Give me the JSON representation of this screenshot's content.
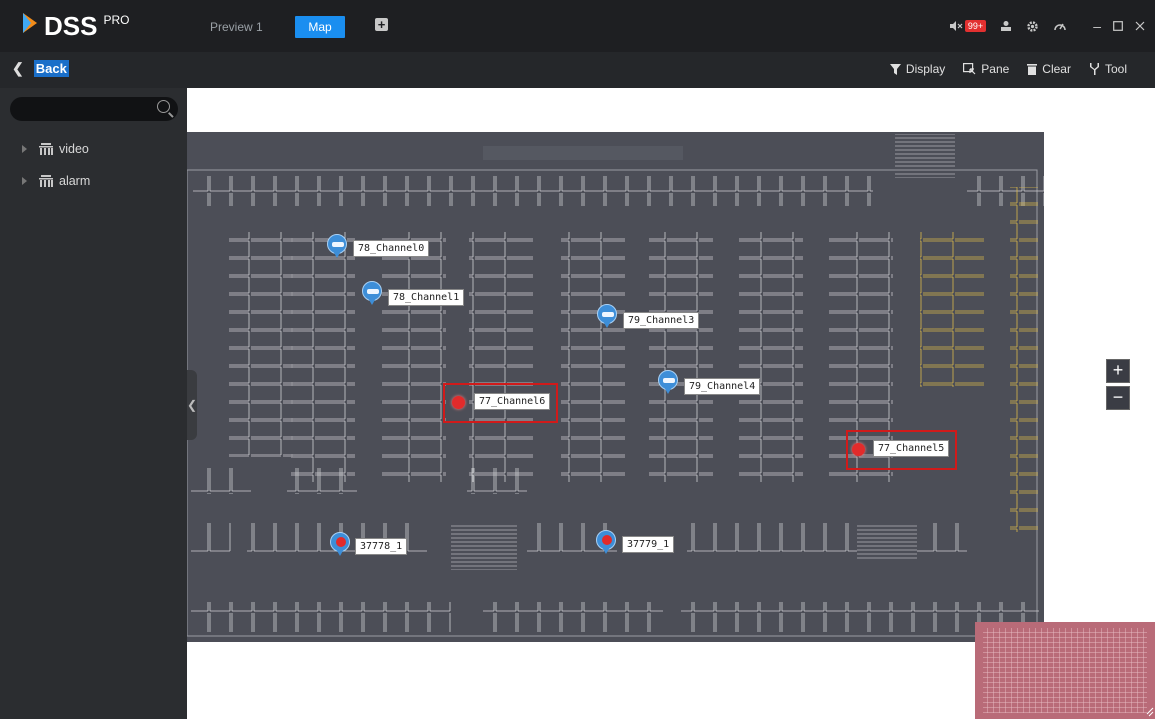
{
  "app": {
    "brand": "DSS",
    "edition": "PRO"
  },
  "tabs": [
    {
      "label": "Preview 1",
      "active": false
    },
    {
      "label": "Map",
      "active": true
    }
  ],
  "titlebar_icons": [
    "mute-icon",
    "notification-count",
    "user-icon",
    "settings-icon",
    "performance-icon",
    "minimize-icon",
    "maximize-icon",
    "close-icon"
  ],
  "notification_count": "99+",
  "subbar": {
    "back_label": "Back",
    "tools": [
      {
        "label": "Display",
        "icon": "filter-icon"
      },
      {
        "label": "Pane",
        "icon": "pane-icon"
      },
      {
        "label": "Clear",
        "icon": "clear-icon"
      },
      {
        "label": "Tool",
        "icon": "tool-icon"
      }
    ]
  },
  "sidebar": {
    "search_placeholder": "",
    "tree": [
      {
        "label": "video",
        "icon": "device-tree-icon"
      },
      {
        "label": "alarm",
        "icon": "device-tree-icon"
      }
    ]
  },
  "map": {
    "channels": [
      {
        "label": "78_Channel0",
        "type": "camera",
        "alarm": false
      },
      {
        "label": "78_Channel1",
        "type": "camera",
        "alarm": false
      },
      {
        "label": "79_Channel3",
        "type": "camera",
        "alarm": false
      },
      {
        "label": "79_Channel4",
        "type": "camera",
        "alarm": false
      },
      {
        "label": "77_Channel6",
        "type": "alarm-input",
        "alarm": true
      },
      {
        "label": "77_Channel5",
        "type": "alarm-input",
        "alarm": true
      },
      {
        "label": "37778_1",
        "type": "camera",
        "alarm": true
      },
      {
        "label": "37779_1",
        "type": "camera",
        "alarm": true
      }
    ],
    "zoom_in": "+",
    "zoom_out": "−"
  },
  "colors": {
    "accent": "#1a8ef0",
    "alarm": "#d11a1a",
    "map_bg": "#4c4e57",
    "badge": "#e23030"
  }
}
